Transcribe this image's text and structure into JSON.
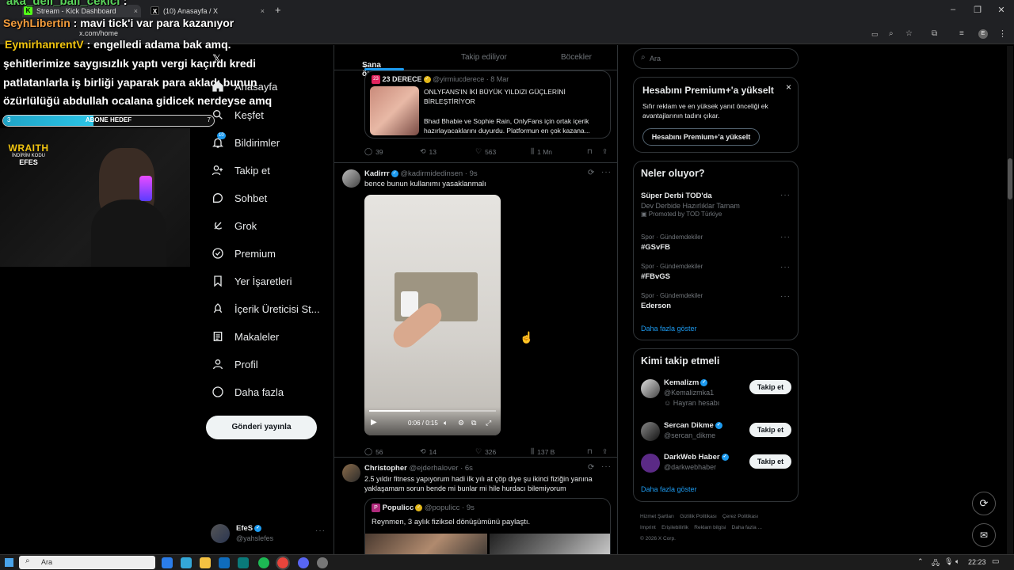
{
  "browser": {
    "tabs": [
      {
        "label": "Stream - Kick Dashboard",
        "icon": "K"
      },
      {
        "label": "(10) Anasayfa / X",
        "icon": "X"
      }
    ],
    "address": "x.com/home",
    "new_tab": "+"
  },
  "stream_overlay": {
    "chat": [
      {
        "user": "aka_deli_bali_cekici",
        "sep": " :",
        "text": ""
      },
      {
        "user": "SeyhLibertin",
        "sep": " :",
        "text": " mavi tick'i var para kazanıyor"
      },
      {
        "user": "EymirhanrentV",
        "sep": " :",
        "text": " engelledi adama bak amq."
      }
    ],
    "chat_lines": [
      "şehitlerimize saygısızlık yaptı vergi kaçırdı kredi",
      "patlatanlarla iş birliği yaparak para akladı bunun",
      "özürlülüğü abdullah ocalana gidicek nerdeyse amq"
    ],
    "goal": {
      "label": "ABONE HEDEF",
      "left": "3",
      "right": "7",
      "progress": 0.43
    },
    "sponsor": {
      "line1": "WRAITH",
      "line2": "İNDİRİM KODU",
      "line3": "EFES"
    }
  },
  "sidebar": {
    "home_label": "Anasayfa",
    "items": [
      {
        "label": "Keşfet",
        "icon": "search-icon"
      },
      {
        "label": "Bildirimler",
        "icon": "bell-icon",
        "badge": "10"
      },
      {
        "label": "Takip et",
        "icon": "person-add-icon"
      },
      {
        "label": "Sohbet",
        "icon": "chat-icon"
      },
      {
        "label": "Grok",
        "icon": "grok-icon"
      },
      {
        "label": "Premium",
        "icon": "premium-icon"
      },
      {
        "label": "Yer İşaretleri",
        "icon": "bookmark-icon"
      },
      {
        "label": "İçerik Üreticisi St...",
        "icon": "rocket-icon"
      },
      {
        "label": "Makaleler",
        "icon": "article-icon"
      },
      {
        "label": "Profil",
        "icon": "profile-icon"
      },
      {
        "label": "Daha fazla",
        "icon": "more-icon"
      }
    ],
    "post_button": "Gönderi yayınla",
    "account": {
      "name": "EfeS",
      "handle": "@yahslefes",
      "more": "···"
    }
  },
  "feed": {
    "tabs": [
      "Sana özel",
      "Takip ediliyor",
      "Böcekler"
    ],
    "tweets": [
      {
        "quote": {
          "author": "23 DERECE",
          "handle": "@yirmiucderece",
          "time": "· 8 Mar",
          "title": "ONLYFANS'IN İKİ BÜYÜK YILDIZI GÜÇLERİNİ BİRLEŞTİRİYOR",
          "body": "Bhad Bhabie ve Sophie Rain, OnlyFans için ortak içerik hazırlayacaklarını duyurdu. Platformun en çok kazana..."
        },
        "stats": {
          "replies": "39",
          "reposts": "13",
          "likes": "563",
          "views": "1 Mn"
        }
      },
      {
        "author": "Kadirrr",
        "handle": "@kadirmidedinsen",
        "time": "· 9s",
        "text": "bence bunun kullanımı yasaklanmalı",
        "video": {
          "time": "0:06 / 0:15",
          "progress": 0.4
        },
        "stats": {
          "replies": "56",
          "reposts": "14",
          "likes": "326",
          "views": "137 B"
        }
      },
      {
        "author": "Christopher",
        "handle": "@ejderhalover",
        "time": "· 6s",
        "text": "2.5 yıldır fitness yapıyorum hadi ilk yılı at çöp diye şu ikinci fiziğin yanına yaklaşamam sorun bende mi bunlar mi hile hurdacı bilemiyorum",
        "quote": {
          "author": "Populicc",
          "handle": "@populicc",
          "time": "· 9s",
          "body": "Reynmen, 3 aylık fiziksel dönüşümünü paylaştı."
        }
      }
    ]
  },
  "right": {
    "search_placeholder": "Ara",
    "premium": {
      "title": "Hesabını Premium+'a yükselt",
      "body": "Sıfır reklam ve en yüksek yanıt önceliği ek avantajlarının tadını çıkar.",
      "button": "Hesabını Premium+'a yükselt",
      "close": "×"
    },
    "trends_title": "Neler oluyor?",
    "trends": [
      {
        "title": "Süper Derbi TOD'da",
        "sub": "Dev Derbide Hazırlıklar Tamam",
        "promo": "Promoted by TOD Türkiye"
      },
      {
        "meta": "Spor · Gündemdekiler",
        "title": "#GSvFB"
      },
      {
        "meta": "Spor · Gündemdekiler",
        "title": "#FBvGS"
      },
      {
        "meta": "Spor · Gündemdekiler",
        "title": "Ederson"
      }
    ],
    "show_more": "Daha fazla göster",
    "follow_title": "Kimi takip etmeli",
    "follow": [
      {
        "name": "Kemalizm",
        "handle": "@Kemalizmka1",
        "note": "Hayran hesabı",
        "button": "Takip et"
      },
      {
        "name": "Sercan Dikme",
        "handle": "@sercan_dikme",
        "button": "Takip et"
      },
      {
        "name": "DarkWeb Haber",
        "handle": "@darkwebhaber",
        "button": "Takip et"
      }
    ],
    "follow_more": "Daha fazla göster",
    "footer": {
      "line1": [
        "Hizmet Şartları",
        "Gizlilik Politikası",
        "Çerez Politikası"
      ],
      "line2": [
        "Imprint",
        "Erişilebilirlik",
        "Reklam bilgisi",
        "Daha fazla ..."
      ],
      "copyright": "© 2026 X Corp."
    }
  },
  "taskbar": {
    "search": "Ara",
    "time": "22:23"
  }
}
